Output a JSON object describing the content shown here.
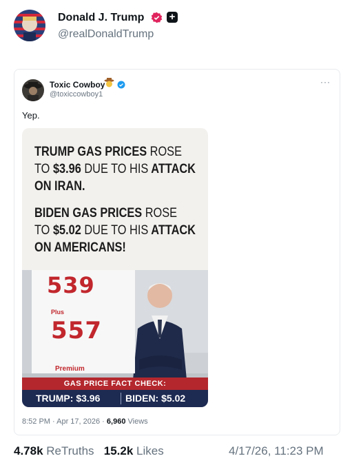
{
  "post": {
    "author_name": "Donald J. Trump",
    "handle": "@realDonaldTrump",
    "retruths_count": "4.78k",
    "retruths_label": "ReTruths",
    "likes_count": "15.2k",
    "likes_label": "Likes",
    "timestamp": "4/17/26, 11:23 PM"
  },
  "quoted": {
    "author_name": "Toxic Cowboy",
    "handle": "@toxiccowboy1",
    "text": "Yep.",
    "more": "···",
    "time": "8:52 PM · Apr 17, 2026 · ",
    "views_count": "6,960",
    "views_label": "Views"
  },
  "media": {
    "line1_bold": "TRUMP GAS PRICES",
    "line1_light": "ROSE",
    "line2_light": "TO",
    "line2_bold": "$3.96",
    "line2_light2": "DUE TO HIS",
    "line2_bold2": "ATTACK",
    "line3": "ON IRAN.",
    "line4_bold": "BIDEN GAS PRICES",
    "line4_light": "ROSE",
    "line5_light": "TO",
    "line5_bold": "$5.02",
    "line5_light2": "DUE TO HIS",
    "line5_bold2": "ATTACK",
    "line6": "ON AMERICANS!",
    "sign_price_1": "539",
    "sign_plus": "Plus",
    "sign_price_2": "557",
    "sign_premium": "Premium",
    "banner_title": "GAS PRICE FACT CHECK:",
    "banner_left": "TRUMP: $3.96",
    "banner_right": "BIDEN: $5.02"
  },
  "colors": {
    "accent_red": "#c1272d",
    "navy": "#1d2a52",
    "verify_blue": "#1d9bf0",
    "verify_pink": "#e0245e"
  },
  "icons": {
    "verify": "verified-badge-icon",
    "plus": "plus-icon",
    "cowboy": "cowboy-emoji-icon"
  }
}
